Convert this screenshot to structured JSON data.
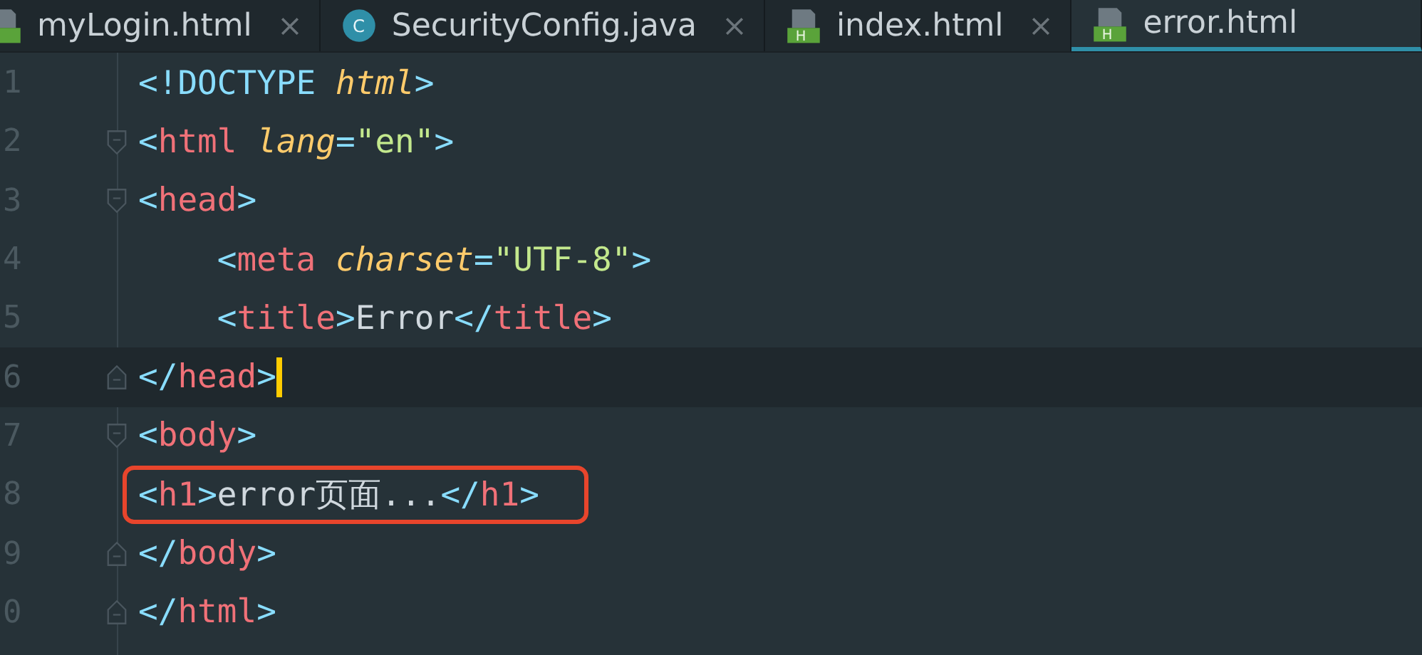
{
  "tabs": [
    {
      "label": "myLogin.html",
      "icon": {
        "kind": "html"
      },
      "close": true,
      "selected": false
    },
    {
      "label": "SecurityConfig.java",
      "icon": {
        "kind": "java",
        "letter": "C"
      },
      "close": true,
      "selected": false
    },
    {
      "label": "index.html",
      "icon": {
        "kind": "html",
        "letter": "H"
      },
      "close": true,
      "selected": false
    },
    {
      "label": "error.html",
      "icon": {
        "kind": "html",
        "letter": "H"
      },
      "close": false,
      "selected": true
    }
  ],
  "editor": {
    "lines": [
      {
        "number": "1",
        "fold_start": false,
        "fold_end": false,
        "current": false,
        "highlighted": false,
        "tokens": [
          {
            "kind": "bracket",
            "text": "<!DOCTYPE "
          },
          {
            "kind": "attr",
            "text": "html"
          },
          {
            "kind": "bracket",
            "text": ">"
          }
        ]
      },
      {
        "number": "2",
        "fold_start": true,
        "fold_end": false,
        "current": false,
        "highlighted": false,
        "tokens": [
          {
            "kind": "bracket",
            "text": "<"
          },
          {
            "kind": "tag",
            "text": "html "
          },
          {
            "kind": "attr",
            "text": "lang"
          },
          {
            "kind": "bracket",
            "text": "="
          },
          {
            "kind": "string",
            "text": "\"en\""
          },
          {
            "kind": "bracket",
            "text": ">"
          }
        ]
      },
      {
        "number": "3",
        "fold_start": true,
        "fold_end": false,
        "current": false,
        "highlighted": false,
        "tokens": [
          {
            "kind": "bracket",
            "text": "<"
          },
          {
            "kind": "tag",
            "text": "head"
          },
          {
            "kind": "bracket",
            "text": ">"
          }
        ]
      },
      {
        "number": "4",
        "fold_start": false,
        "fold_end": false,
        "current": false,
        "highlighted": false,
        "tokens": [
          {
            "kind": "bracket",
            "text": "    <"
          },
          {
            "kind": "tag",
            "text": "meta "
          },
          {
            "kind": "attr",
            "text": "charset"
          },
          {
            "kind": "bracket",
            "text": "="
          },
          {
            "kind": "string",
            "text": "\"UTF-8\""
          },
          {
            "kind": "bracket",
            "text": ">"
          }
        ]
      },
      {
        "number": "5",
        "fold_start": false,
        "fold_end": false,
        "current": false,
        "highlighted": false,
        "tokens": [
          {
            "kind": "bracket",
            "text": "    <"
          },
          {
            "kind": "tag",
            "text": "title"
          },
          {
            "kind": "bracket",
            "text": ">"
          },
          {
            "kind": "text",
            "text": "Error"
          },
          {
            "kind": "bracket",
            "text": "</"
          },
          {
            "kind": "tag",
            "text": "title"
          },
          {
            "kind": "bracket",
            "text": ">"
          }
        ]
      },
      {
        "number": "6",
        "fold_start": false,
        "fold_end": true,
        "current": true,
        "highlighted": false,
        "tokens": [
          {
            "kind": "bracket",
            "text": "</"
          },
          {
            "kind": "tag",
            "text": "head"
          },
          {
            "kind": "bracket",
            "text": ">"
          }
        ]
      },
      {
        "number": "7",
        "fold_start": true,
        "fold_end": false,
        "current": false,
        "highlighted": false,
        "tokens": [
          {
            "kind": "bracket",
            "text": "<"
          },
          {
            "kind": "tag",
            "text": "body"
          },
          {
            "kind": "bracket",
            "text": ">"
          }
        ]
      },
      {
        "number": "8",
        "fold_start": false,
        "fold_end": false,
        "current": false,
        "highlighted": true,
        "tokens": [
          {
            "kind": "bracket",
            "text": "<"
          },
          {
            "kind": "tag",
            "text": "h1"
          },
          {
            "kind": "bracket",
            "text": ">"
          },
          {
            "kind": "text",
            "text": "error页面..."
          },
          {
            "kind": "bracket",
            "text": "</"
          },
          {
            "kind": "tag",
            "text": "h1"
          },
          {
            "kind": "bracket",
            "text": ">"
          }
        ]
      },
      {
        "number": "9",
        "fold_start": false,
        "fold_end": true,
        "current": false,
        "highlighted": false,
        "tokens": [
          {
            "kind": "bracket",
            "text": "</"
          },
          {
            "kind": "tag",
            "text": "body"
          },
          {
            "kind": "bracket",
            "text": ">"
          }
        ]
      },
      {
        "number": "0",
        "fold_start": false,
        "fold_end": true,
        "current": false,
        "highlighted": false,
        "tokens": [
          {
            "kind": "bracket",
            "text": "</"
          },
          {
            "kind": "tag",
            "text": "html"
          },
          {
            "kind": "bracket",
            "text": ">"
          }
        ]
      }
    ]
  }
}
